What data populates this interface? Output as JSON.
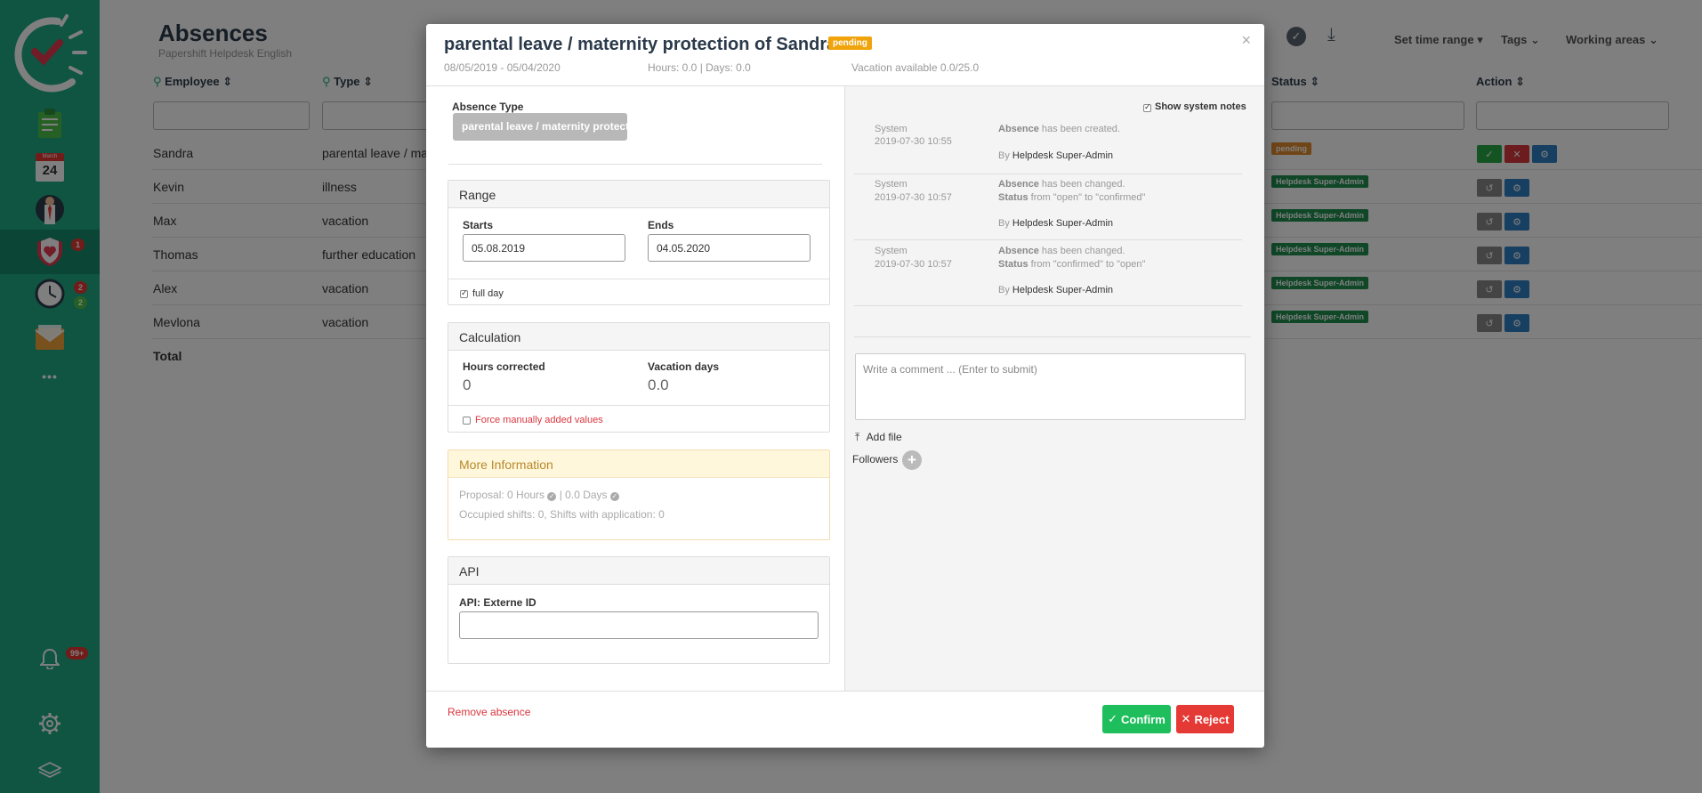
{
  "sidebar": {
    "calendar_month": "March",
    "calendar_day": "24",
    "absences_badge": "1",
    "time_badge_1": "2",
    "time_badge_2": "2",
    "more": "•••",
    "notifications_badge": "99+"
  },
  "page": {
    "title": "Absences",
    "subtitle": "Papershift Helpdesk English",
    "columns": {
      "employee": "Employee",
      "type": "Type",
      "status": "Status",
      "action": "Action"
    },
    "toolbar": {
      "set_time_range": "Set time range",
      "tags": "Tags",
      "working_areas": "Working areas"
    },
    "rows": [
      {
        "employee": "Sandra",
        "type": "parental leave / mate",
        "status": "pending"
      },
      {
        "employee": "Kevin",
        "type": "illness",
        "status": "Helpdesk Super-Admin"
      },
      {
        "employee": "Max",
        "type": "vacation",
        "status": "Helpdesk Super-Admin"
      },
      {
        "employee": "Thomas",
        "type": "further education",
        "status": "Helpdesk Super-Admin"
      },
      {
        "employee": "Alex",
        "type": "vacation",
        "status": "Helpdesk Super-Admin"
      },
      {
        "employee": "Mevlona",
        "type": "vacation",
        "status": "Helpdesk Super-Admin"
      }
    ],
    "total": "Total"
  },
  "modal": {
    "title": "parental leave / maternity protection of Sandra",
    "status": "pending",
    "date_range": "08/05/2019 - 05/04/2020",
    "hours_days": "Hours: 0.0 | Days: 0.0",
    "vacation_available": "Vacation available 0.0/25.0",
    "absence_type_label": "Absence Type",
    "absence_type_value": "parental leave / maternity protect",
    "range": {
      "title": "Range",
      "starts_label": "Starts",
      "starts_value": "05.08.2019",
      "ends_label": "Ends",
      "ends_value": "04.05.2020",
      "full_day": "full day"
    },
    "calculation": {
      "title": "Calculation",
      "hours_label": "Hours corrected",
      "hours_value": "0",
      "vacation_label": "Vacation days",
      "vacation_value": "0.0",
      "force": "Force manually added values"
    },
    "more_info": {
      "title": "More Information",
      "proposal_hours": "Proposal: 0 Hours",
      "proposal_sep": "| 0.0 Days",
      "occupied": "Occupied shifts: 0, Shifts with application: 0"
    },
    "api": {
      "title": "API",
      "label": "API: Externe ID",
      "value": ""
    },
    "notes": {
      "show_system": "Show system notes",
      "items": [
        {
          "who": "System",
          "time": "2019-07-30 10:55",
          "line1_b": "Absence",
          "line1": " has been created.",
          "line2_b": "",
          "line2": "",
          "by": "By ",
          "by_name": "Helpdesk Super-Admin"
        },
        {
          "who": "System",
          "time": "2019-07-30 10:57",
          "line1_b": "Absence",
          "line1": " has been changed.",
          "line2_b": "Status",
          "line2": " from \"open\" to \"confirmed\"",
          "by": "By ",
          "by_name": "Helpdesk Super-Admin"
        },
        {
          "who": "System",
          "time": "2019-07-30 10:57",
          "line1_b": "Absence",
          "line1": " has been changed.",
          "line2_b": "Status",
          "line2": " from \"confirmed\" to \"open\"",
          "by": "By ",
          "by_name": "Helpdesk Super-Admin"
        }
      ],
      "comment_placeholder": "Write a comment ... (Enter to submit)",
      "add_file": "Add file",
      "followers": "Followers"
    },
    "footer": {
      "remove": "Remove absence",
      "confirm": "Confirm",
      "reject": "Reject"
    }
  }
}
